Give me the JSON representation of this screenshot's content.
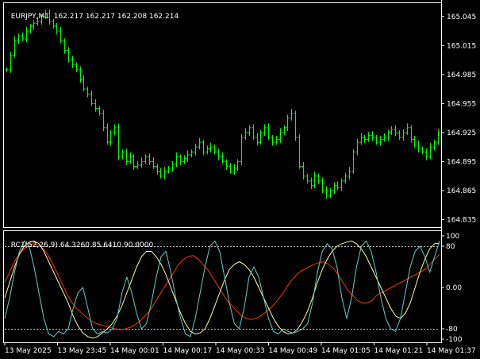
{
  "window": {
    "symbol_header": "EURJPY,M1",
    "ohlc": "162.217 162.217 162.208 162.214"
  },
  "indicator": {
    "header": "RC1(52,26,9)",
    "values": "64.3260 85.6410 90.0000",
    "levels": {
      "upper": 80,
      "lower": -80
    }
  },
  "colors": {
    "background": "#000000",
    "candles": "#00ff00",
    "grid_frame": "#ffffff",
    "line_slow": "#ff3300",
    "line_mid": "#ffff99",
    "line_fast": "#66cccc",
    "level_lines": "#c0c0c0"
  },
  "chart_data": [
    {
      "type": "line",
      "title": "EURJPY,M1",
      "price_axis_labels": [
        "165.045",
        "165.015",
        "164.985",
        "164.955",
        "164.925",
        "164.895",
        "164.865",
        "164.835"
      ],
      "ylim": [
        164.828,
        165.058
      ],
      "x_axis_labels": [
        "13 May 2025",
        "13 May 23:45",
        "14 May 00:01",
        "14 May 00:17",
        "14 May 00:33",
        "14 May 00:49",
        "14 May 01:05",
        "14 May 01:21",
        "14 May 01:37"
      ],
      "series": [
        {
          "close": [
            164.99,
            165.005,
            165.02,
            165.025,
            165.022,
            165.03,
            165.035,
            165.038,
            165.04,
            165.045,
            165.048,
            165.04,
            165.035,
            165.03,
            165.02,
            165.01,
            165.0,
            164.995,
            164.99,
            164.98,
            164.97,
            164.965,
            164.955,
            164.95,
            164.945,
            164.93,
            164.915,
            164.925,
            164.93,
            164.9,
            164.905,
            164.895,
            164.9,
            164.89,
            164.892,
            164.895,
            164.9,
            164.895,
            164.89,
            164.885,
            164.88,
            164.885,
            164.888,
            164.892,
            164.9,
            164.895,
            164.898,
            164.902,
            164.905,
            164.91,
            164.915,
            164.905,
            164.908,
            164.91,
            164.905,
            164.9,
            164.895,
            164.89,
            164.885,
            164.888,
            164.895,
            164.92,
            164.925,
            164.93,
            164.92,
            164.915,
            164.925,
            164.93,
            164.92,
            164.915,
            164.918,
            164.925,
            164.93,
            164.94,
            164.945,
            164.92,
            164.89,
            164.88,
            164.875,
            164.87,
            164.88,
            164.875,
            164.865,
            164.86,
            164.865,
            164.87,
            164.868,
            164.875,
            164.88,
            164.885,
            164.905,
            164.915,
            164.92,
            164.918,
            164.922,
            164.92,
            164.915,
            164.918,
            164.92,
            164.925,
            164.928,
            164.925,
            164.92,
            164.925,
            164.93,
            164.918,
            164.912,
            164.908,
            164.905,
            164.9,
            164.91,
            164.915,
            164.925
          ]
        }
      ]
    },
    {
      "type": "line",
      "title": "RC1(52,26,9)",
      "y_axis_labels": [
        "100",
        "80",
        "0.00",
        "-80",
        "-100"
      ],
      "ylim": [
        -100,
        100
      ],
      "reference_lines": [
        80,
        -80
      ],
      "series": [
        {
          "name": "64.3260",
          "values": [
            10,
            30,
            50,
            65,
            75,
            82,
            85,
            82,
            75,
            62,
            45,
            25,
            5,
            -15,
            -30,
            -42,
            -50,
            -58,
            -65,
            -70,
            -73,
            -75,
            -78,
            -80,
            -82,
            -80,
            -77,
            -72,
            -65,
            -55,
            -45,
            -30,
            -15,
            0,
            15,
            30,
            45,
            55,
            60,
            62,
            55,
            45,
            35,
            20,
            5,
            -10,
            -25,
            -35,
            -45,
            -55,
            -60,
            -62,
            -60,
            -55,
            -48,
            -40,
            -30,
            -18,
            -5,
            10,
            20,
            30,
            35,
            40,
            45,
            48,
            50,
            45,
            38,
            25,
            10,
            -5,
            -15,
            -25,
            -30,
            -30,
            -25,
            -15,
            -10,
            -5,
            0,
            5,
            10,
            15,
            20,
            25,
            30,
            35,
            45,
            55,
            64
          ]
        },
        {
          "name": "85.6410",
          "values": [
            -20,
            10,
            40,
            65,
            80,
            88,
            90,
            85,
            70,
            50,
            30,
            10,
            -10,
            -30,
            -55,
            -75,
            -88,
            -95,
            -98,
            -95,
            -88,
            -80,
            -70,
            -55,
            -35,
            -10,
            15,
            40,
            60,
            70,
            70,
            60,
            45,
            25,
            0,
            -25,
            -50,
            -70,
            -85,
            -90,
            -88,
            -80,
            -60,
            -35,
            -10,
            15,
            35,
            45,
            50,
            45,
            35,
            20,
            0,
            -20,
            -40,
            -60,
            -75,
            -85,
            -90,
            -88,
            -80,
            -65,
            -45,
            -20,
            10,
            35,
            55,
            70,
            80,
            85,
            88,
            90,
            85,
            75,
            60,
            40,
            20,
            0,
            -20,
            -40,
            -55,
            -60,
            -50,
            -30,
            0,
            30,
            55,
            75,
            85,
            86
          ]
        },
        {
          "name": "90.0000",
          "values": [
            -60,
            -20,
            30,
            70,
            90,
            80,
            40,
            -10,
            -60,
            -90,
            -95,
            -85,
            -90,
            -80,
            -40,
            -10,
            0,
            -40,
            -80,
            -90,
            -85,
            -88,
            -80,
            -60,
            -10,
            20,
            -10,
            -50,
            -80,
            -70,
            -30,
            20,
            60,
            70,
            30,
            -20,
            -60,
            -90,
            -95,
            -60,
            -10,
            40,
            80,
            90,
            70,
            20,
            -30,
            -70,
            -80,
            -40,
            20,
            40,
            20,
            -20,
            -60,
            -85,
            -90,
            -80,
            -85,
            -88,
            -85,
            -80,
            -70,
            -30,
            30,
            70,
            85,
            75,
            40,
            -20,
            -60,
            -20,
            40,
            80,
            90,
            70,
            30,
            -20,
            -60,
            -80,
            -85,
            -60,
            -10,
            40,
            70,
            80,
            60,
            30,
            60,
            90
          ]
        }
      ]
    }
  ]
}
